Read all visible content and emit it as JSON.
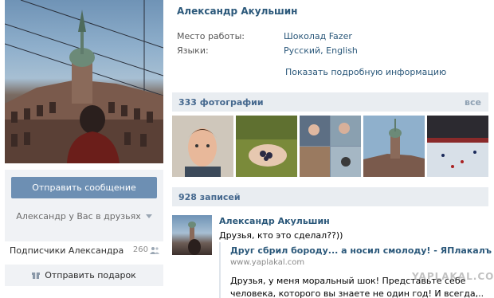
{
  "profile": {
    "name": "Александр Акульшин",
    "work_label": "Место работы:",
    "work_value": "Шоколад Fazer",
    "languages_label": "Языки:",
    "languages_value": "Русский, English",
    "more_info_link": "Показать подробную информацию"
  },
  "sidebar": {
    "send_message_button": "Отправить сообщение",
    "friend_status": "Александр у Вас в друзьях",
    "subscribers_label": "Подписчики Александра",
    "subscribers_count": "260",
    "gift_button": "Отправить подарок"
  },
  "photos": {
    "title": "333 фотографии",
    "all_link": "все"
  },
  "wall": {
    "title": "928 записей",
    "post": {
      "author": "Александр Акульшин",
      "text": "Друзья, кто это сделал??))",
      "attachment_title": "Друг сбрил бороду... а носил смолоду! - ЯПлакалъ",
      "attachment_url": "www.yaplakal.com",
      "attachment_desc": "Друзья, у меня моральный шок! Представьте себе человека, которого вы знаете не один год! И всегда,.."
    }
  },
  "watermark": "YAPLAKAL.COM",
  "colors": {
    "link": "#2b587a",
    "bar_bg": "#e9edf1",
    "button_bg": "#6d8fb3",
    "panel_bg": "#f0f2f5"
  }
}
